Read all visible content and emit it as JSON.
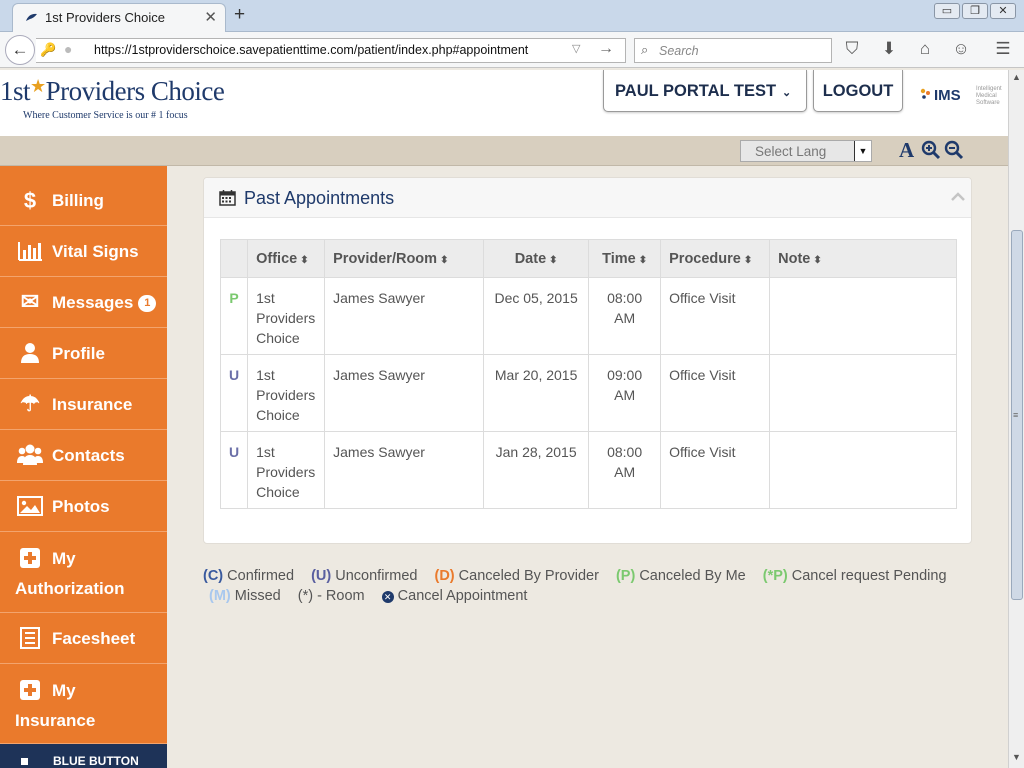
{
  "browser": {
    "tab_title": "1st Providers Choice",
    "tab_close": "✕",
    "new_tab": "+",
    "url": "https://1stproviderschoice.savepatienttime.com/patient/index.php#appointment",
    "search_placeholder": "Search",
    "window_controls": [
      "▭",
      "❐",
      "✕"
    ]
  },
  "header": {
    "logo_prefix": "1st",
    "logo_star": "★",
    "logo_suffix": "Providers Choice",
    "logo_tagline": "Where Customer Service is our # 1 focus",
    "user_label": "PAUL PORTAL TEST",
    "user_caret": "⌄",
    "logout_label": "LOGOUT",
    "ims_text": "IMS",
    "ims_sub": "Intelligent Medical Software",
    "lang_placeholder": "Select Lang",
    "lang_arrow": "▼",
    "font_size_label": "A"
  },
  "sidebar": {
    "items": [
      {
        "label": "Billing",
        "icon": "$"
      },
      {
        "label": "Vital Signs",
        "icon": "▮"
      },
      {
        "label": "Messages",
        "icon": "✉",
        "badge": "1"
      },
      {
        "label": "Profile",
        "icon": "●"
      },
      {
        "label": "Insurance",
        "icon": "☂"
      },
      {
        "label": "Contacts",
        "icon": "☻"
      },
      {
        "label": "Photos",
        "icon": "▣"
      },
      {
        "label_line1": "My",
        "label_line2": "Authorization",
        "icon": "✚"
      },
      {
        "label": "Facesheet",
        "icon": "▤"
      },
      {
        "label_line1": "My",
        "label_line2": "Insurance",
        "icon": "✚"
      }
    ],
    "blue_button_label": "BLUE BUTTON"
  },
  "panel": {
    "title": "Past Appointments",
    "columns": [
      "",
      "Office",
      "Provider/Room",
      "Date",
      "Time",
      "Procedure",
      "Note"
    ],
    "sort_glyph": "⬍",
    "rows": [
      {
        "status": "P",
        "office": "1st Providers Choice",
        "provider": "James Sawyer",
        "date": "Dec 05, 2015",
        "time": "08:00 AM",
        "procedure": "Office Visit",
        "note": ""
      },
      {
        "status": "U",
        "office": "1st Providers Choice",
        "provider": "James Sawyer",
        "date": "Mar 20, 2015",
        "time": "09:00 AM",
        "procedure": "Office Visit",
        "note": ""
      },
      {
        "status": "U",
        "office": "1st Providers Choice",
        "provider": "James Sawyer",
        "date": "Jan 28, 2015",
        "time": "08:00 AM",
        "procedure": "Office Visit",
        "note": ""
      }
    ]
  },
  "legend": {
    "confirmed_code": "(C)",
    "confirmed": "Confirmed",
    "unconfirmed_code": "(U)",
    "unconfirmed": "Unconfirmed",
    "canceled_provider_code": "(D)",
    "canceled_provider": "Canceled By Provider",
    "canceled_me_code": "(P)",
    "canceled_me": "Canceled By Me",
    "cancel_pending_code": "(*P)",
    "cancel_pending": "Cancel request Pending",
    "missed_code": "(M)",
    "missed": "Missed",
    "room": "(*) - Room",
    "cancel_icon": "✕",
    "cancel_appointment": "Cancel Appointment"
  },
  "colors": {
    "sidebar_orange": "#ea7a2c",
    "navy": "#1f3a6b",
    "lang_bar": "#d8cfbf",
    "page_bg": "#ede9e1",
    "status_p_green": "#7bc96f",
    "status_u_purple": "#6b6fa8"
  }
}
